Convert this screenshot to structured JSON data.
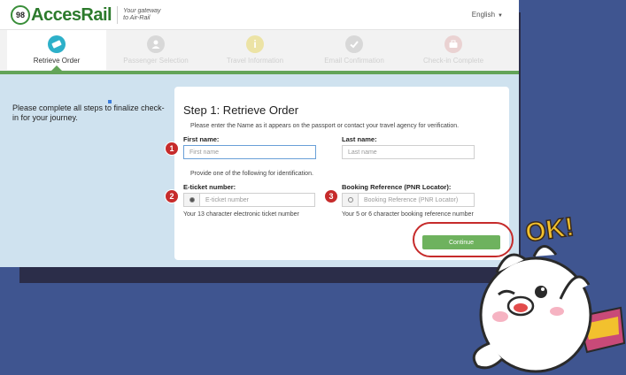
{
  "header": {
    "logo_mark": "98",
    "logo_text": "AccesRail",
    "tagline_line1": "Your gateway",
    "tagline_line2": "to Air-Rail",
    "language": "English"
  },
  "steps": [
    {
      "label": "Retrieve Order",
      "icon": "ticket-icon",
      "active": true
    },
    {
      "label": "Passenger Selection",
      "icon": "user-icon",
      "active": false
    },
    {
      "label": "Travel Information",
      "icon": "info-icon",
      "active": false
    },
    {
      "label": "Email Confirmation",
      "icon": "check-icon",
      "active": false
    },
    {
      "label": "Check-in Complete",
      "icon": "briefcase-icon",
      "active": false
    }
  ],
  "intro": "Please complete all steps to finalize check-in for your journey.",
  "form": {
    "title": "Step 1: Retrieve Order",
    "instruction": "Please enter the Name as it appears on the passport or contact your travel agency for verification.",
    "first_name_label": "First name:",
    "first_name_placeholder": "First name",
    "last_name_label": "Last name:",
    "last_name_placeholder": "Last name",
    "identification_hint": "Provide one of the following for identification.",
    "eticket_label": "E-ticket number:",
    "eticket_placeholder": "E-ticket number",
    "eticket_help": "Your 13 character electronic ticket number",
    "booking_label": "Booking Reference (PNR Locator):",
    "booking_placeholder": "Booking Reference (PNR Locator)",
    "booking_help": "Your 5 or 6 character booking reference number",
    "continue_label": "Continue"
  },
  "annotations": {
    "badge1": "1",
    "badge2": "2",
    "badge3": "3",
    "sticker_text": "OK!"
  },
  "colors": {
    "accent_green": "#6eb25e",
    "active_step": "#2db0c9",
    "annotation_red": "#c62b2b",
    "background": "#3f5590"
  }
}
